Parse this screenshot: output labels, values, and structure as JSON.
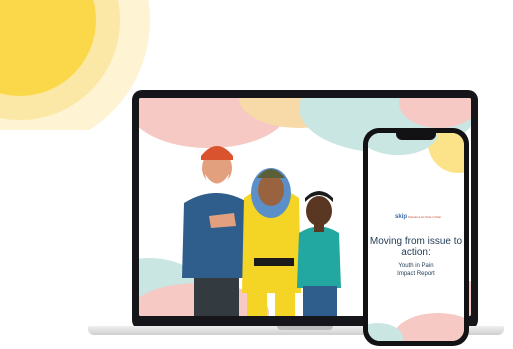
{
  "phone": {
    "logo": "skip",
    "logo_tagline": "Solutions for Kids in Pain",
    "title": "Moving from issue to action:",
    "subtitle_line1": "Youth in Pain",
    "subtitle_line2": "Impact Report"
  },
  "colors": {
    "sun_yellow": "#FBD84A",
    "pink_blob": "#F6C9C4",
    "teal_blob": "#BFE3DF",
    "navy_text": "#1F3A57"
  }
}
